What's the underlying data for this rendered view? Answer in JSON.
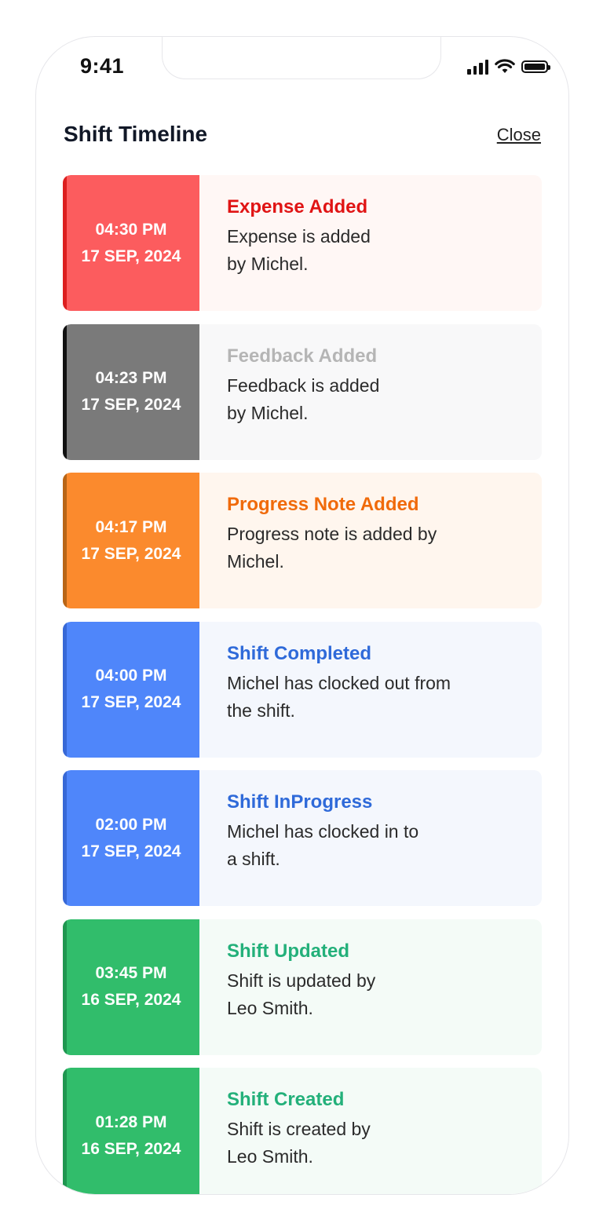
{
  "status_bar": {
    "time": "9:41"
  },
  "header": {
    "title": "Shift Timeline",
    "close_label": "Close"
  },
  "timeline": [
    {
      "time": "04:30 PM",
      "date": "17 SEP, 2024",
      "title": "Expense Added",
      "description": "Expense is  added\nby Michel.",
      "colors": {
        "block": "#fc5c5e",
        "edge": "#dc1f1f",
        "title": "#e01414",
        "bg": "#fff7f5"
      }
    },
    {
      "time": "04:23 PM",
      "date": "17 SEP, 2024",
      "title": "Feedback Added",
      "description": "Feedback is added\nby Michel.",
      "colors": {
        "block": "#7a7a7a",
        "edge": "#111111",
        "title": "#b5b5b5",
        "bg": "#f8f8f9"
      }
    },
    {
      "time": "04:17 PM",
      "date": "17 SEP, 2024",
      "title": "Progress Note Added",
      "description": "Progress note is added by\nMichel.",
      "colors": {
        "block": "#fb8a2d",
        "edge": "#b96516",
        "title": "#f06a0a",
        "bg": "#fff6ee"
      }
    },
    {
      "time": "04:00 PM",
      "date": "17 SEP, 2024",
      "title": "Shift Completed",
      "description": "Michel has clocked out from\nthe shift.",
      "colors": {
        "block": "#4f86fa",
        "edge": "#3768d6",
        "title": "#2f6ad9",
        "bg": "#f4f7fd"
      }
    },
    {
      "time": "02:00 PM",
      "date": "17 SEP, 2024",
      "title": "Shift InProgress",
      "description": "Michel has clocked in to\na shift.",
      "colors": {
        "block": "#4f86fa",
        "edge": "#3768d6",
        "title": "#2f6ad9",
        "bg": "#f4f7fd"
      }
    },
    {
      "time": "03:45 PM",
      "date": "16 SEP, 2024",
      "title": "Shift Updated",
      "description": "Shift is updated by\nLeo Smith.",
      "colors": {
        "block": "#31bd6b",
        "edge": "#1f9650",
        "title": "#23b07a",
        "bg": "#f4fbf7"
      }
    },
    {
      "time": "01:28 PM",
      "date": "16 SEP, 2024",
      "title": "Shift Created",
      "description": "Shift is created by\nLeo Smith.",
      "colors": {
        "block": "#31bd6b",
        "edge": "#1f9650",
        "title": "#23b07a",
        "bg": "#f4fbf7"
      }
    }
  ]
}
